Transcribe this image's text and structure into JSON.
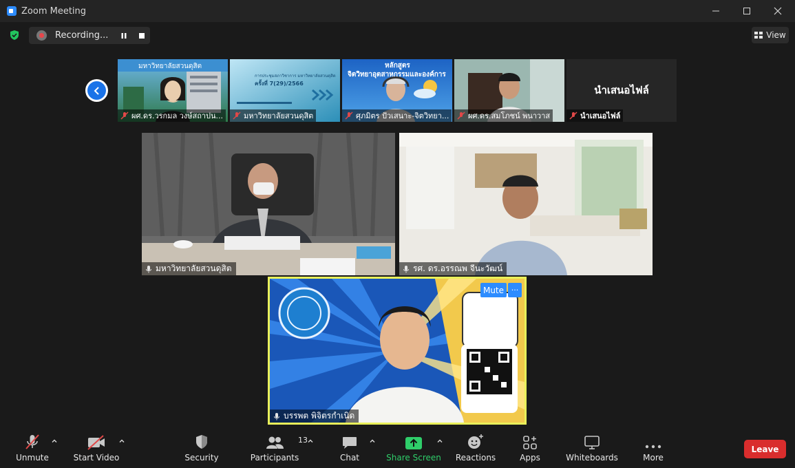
{
  "window": {
    "title": "Zoom Meeting"
  },
  "top_bar": {
    "recording_label": "Recording...",
    "view_label": "View"
  },
  "thumbnails": [
    {
      "name": "ผศ.ดร.วรกมล วงษ์สถาปน...",
      "muted": true
    },
    {
      "name": "มหาวิทยาลัยสวนดุสิต",
      "muted": true
    },
    {
      "name": "ศุภมิตร ปัวเสนาะ-จิตวิทยา...",
      "muted": true
    },
    {
      "name": "ผศ.ดร.สมโภชน์ พนาวาส",
      "muted": true
    },
    {
      "name": "นำเสนอไฟล์",
      "muted": true,
      "center_text": "นำเสนอไฟล์"
    }
  ],
  "thumb_content": {
    "thumb1_banner": "มหาวิทยาลัยสวนดุสิต",
    "thumb2_line1": "การประชุมสภาวิชาการ มหาวิทยาลัยสวนดุสิต",
    "thumb2_line2": "ครั้งที่ 7(29)/2566",
    "thumb3_line1": "หลักสูตร",
    "thumb3_line2": "จิตวิทยาอุตสาหกรรมและองค์การ"
  },
  "tiles": [
    {
      "name": "มหาวิทยาลัยสวนดุสิต"
    },
    {
      "name": "รศ. ดร.อรรณพ จีนะวัฒน์"
    },
    {
      "name": "บรรพต พิจิตรกำเนิด",
      "active": true,
      "mute_label": "Mute",
      "more_label": "···"
    }
  ],
  "toolbar": {
    "unmute": "Unmute",
    "start_video": "Start Video",
    "security": "Security",
    "participants": "Participants",
    "participants_count": "13",
    "chat": "Chat",
    "share_screen": "Share Screen",
    "reactions": "Reactions",
    "apps": "Apps",
    "whiteboards": "Whiteboards",
    "more": "More",
    "leave": "Leave"
  },
  "colors": {
    "accent_blue": "#1a73e8",
    "share_green": "#2fce6a",
    "leave_red": "#d92d2d",
    "active_speaker_border": "#e9f05a",
    "shield_green": "#22c55e"
  }
}
